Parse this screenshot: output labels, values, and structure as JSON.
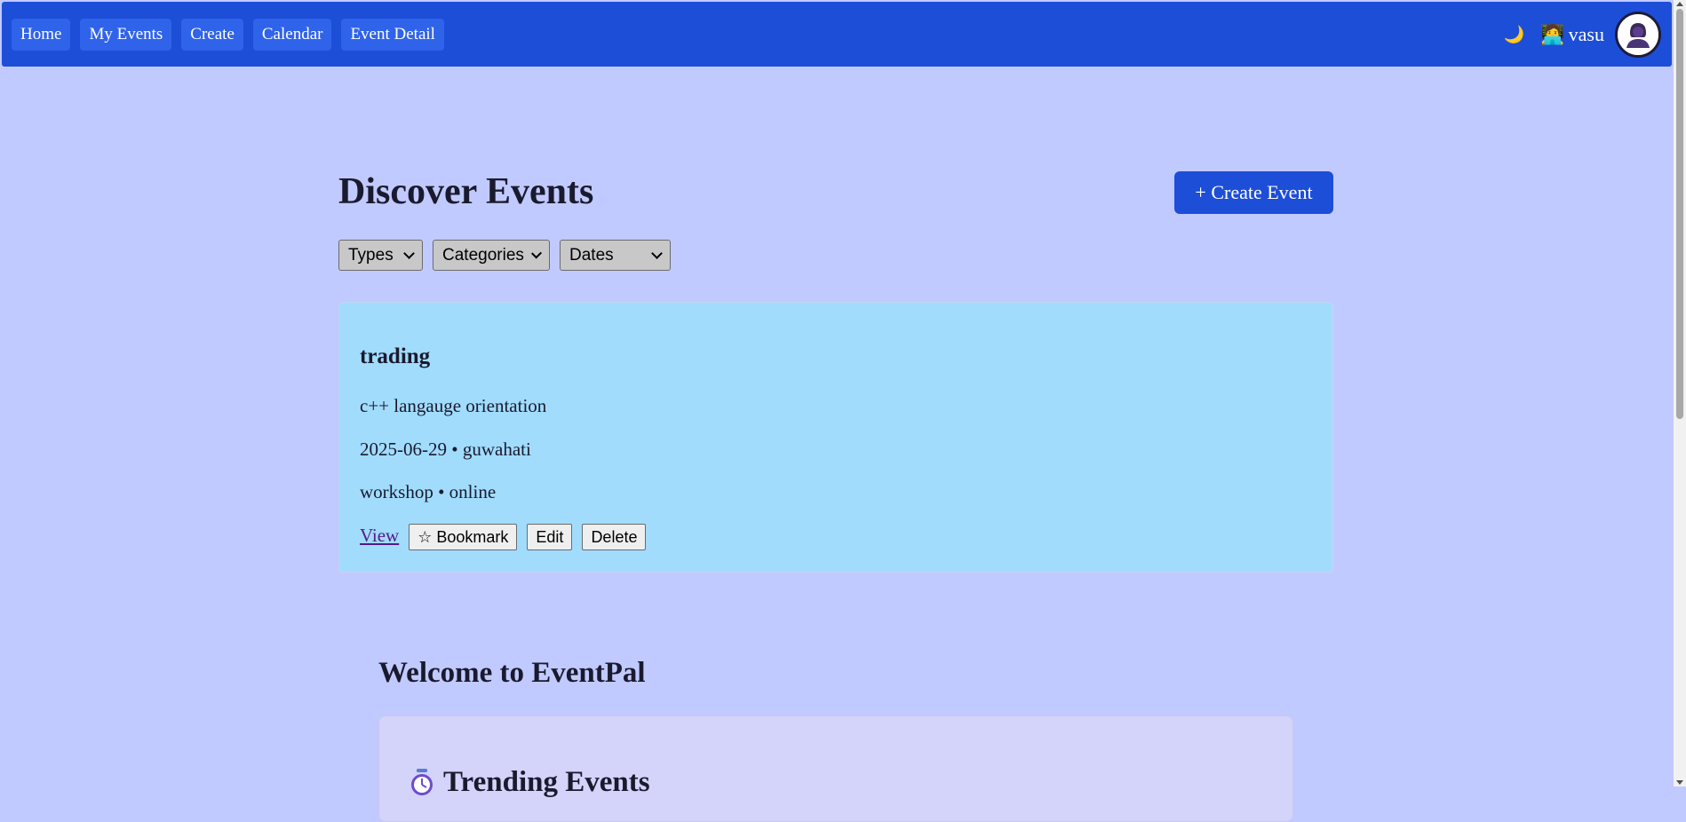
{
  "nav": {
    "links": [
      "Home",
      "My Events",
      "Create",
      "Calendar",
      "Event Detail"
    ],
    "theme_toggle": "🌙",
    "user_glyph": "🧑‍💻",
    "username": "vasu"
  },
  "main": {
    "title": "Discover Events",
    "create_button": "+ Create Event",
    "filters": [
      {
        "selected": "Types"
      },
      {
        "selected": "Categories"
      },
      {
        "selected": "Dates"
      }
    ]
  },
  "events": [
    {
      "title": "trading",
      "description": "c++ langauge orientation",
      "date_location": "2025-06-29 • guwahati",
      "type_mode": "workshop • online",
      "view_label": "View",
      "bookmark_label": "☆ Bookmark",
      "edit_label": "Edit",
      "delete_label": "Delete"
    }
  ],
  "welcome": {
    "title": "Welcome to EventPal",
    "trending_title": "Trending Events"
  },
  "colors": {
    "page_bg": "#c1caff",
    "navbar_bg": "#1d4ed8",
    "card_bg": "#a1dcfd",
    "trending_bg": "#d4d3fa"
  }
}
